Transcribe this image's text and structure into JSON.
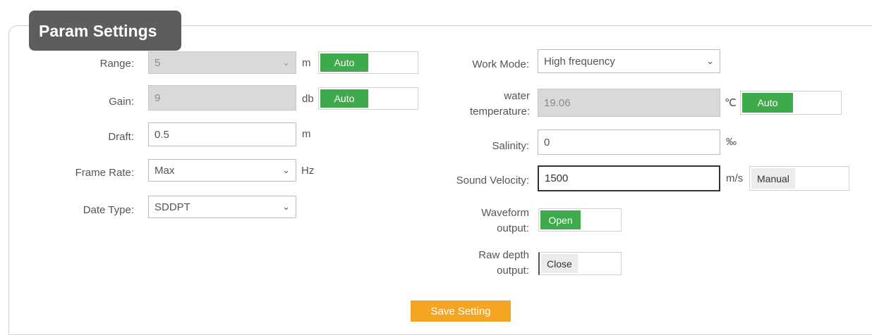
{
  "panel": {
    "title": "Param Settings"
  },
  "left": {
    "range": {
      "label": "Range:",
      "value": "5",
      "unit": "m",
      "toggle": "Auto"
    },
    "gain": {
      "label": "Gain:",
      "value": "9",
      "unit": "db",
      "toggle": "Auto"
    },
    "draft": {
      "label": "Draft:",
      "value": "0.5",
      "unit": "m"
    },
    "frame_rate": {
      "label": "Frame Rate:",
      "value": "Max",
      "unit": "Hz"
    },
    "date_type": {
      "label": "Date Type:",
      "value": "SDDPT"
    }
  },
  "right": {
    "work_mode": {
      "label": "Work Mode:",
      "value": "High frequency"
    },
    "water_temperature": {
      "label_line1": "water",
      "label_line2": "temperature:",
      "value": "19.06",
      "unit": "℃",
      "toggle": "Auto"
    },
    "salinity": {
      "label": "Salinity:",
      "value": "0",
      "unit": "‰"
    },
    "sound_velocity": {
      "label": "Sound Velocity:",
      "value": "1500",
      "unit": "m/s",
      "toggle": "Manual"
    },
    "waveform_output": {
      "label_line1": "Waveform",
      "label_line2": "output:",
      "toggle": "Open"
    },
    "raw_depth_output": {
      "label_line1": "Raw depth",
      "label_line2": "output:",
      "toggle": "Close"
    }
  },
  "save_button": "Save Setting",
  "colors": {
    "title_bg": "#5d5d5d",
    "toggle_on": "#3faa4c",
    "save_button": "#f4a524",
    "disabled_bg": "#d9d9d9"
  }
}
